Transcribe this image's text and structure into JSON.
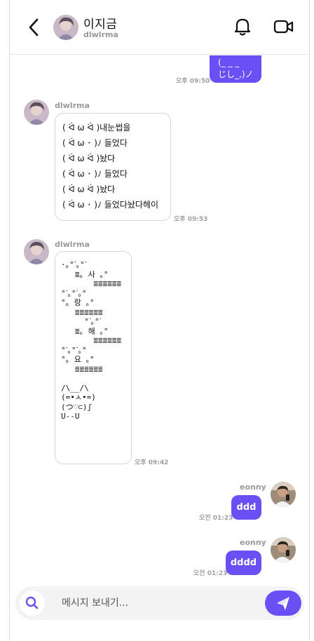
{
  "header": {
    "name": "이지금",
    "username": "dlwlrma"
  },
  "messages": {
    "top_partial": {
      "text_line1": "(_ _ _",
      "text_line2": "じし_,)ノ",
      "time": "오후 09:50"
    },
    "msg1": {
      "sender": "dlwlrma",
      "lines": [
        "( ᐛ ω ᐛ )내눈썹을",
        "( ᐛ ω ･ )ﾉ 들었다",
        "( ᐛ ω ᐛ )놨다",
        "( ᐛ ω ･ )ﾉ 들었다",
        "( ᐛ ω ᐛ )놨다",
        "( ᐛ ω ･ )ﾉ 들었다놨다헤이"
      ],
      "time": "오후 09:53"
    },
    "msg2": {
      "sender": "dlwlrma",
      "art": "·｡°ᐝ｡°ᐝ\n   ≣｡ 사 ｡°\n       ≣≣≣≣≣≣\n°ᐝ｡°ᐝ｡°\n°｡ 랑 ｡°\n   ≣≣≣≣≣≣\n     °ᐝ｡°ᐝ\n   ≣｡ 해 ｡°\n       ≣≣≣≣≣≣\n°ᐝ｡°ᐝ｡°\n°｡ 요 ｡°\n   ≣≣≣≣≣≣\n\n/\\__/\\\n(=•ㅅ•=)\n(つ♡⊂)ʃ\nU--U",
      "time": "오후 09:42"
    },
    "msg3": {
      "sender": "eonny",
      "text": "ddd",
      "time": "오전 01:23"
    },
    "msg4": {
      "sender": "eonny",
      "text": "dddd",
      "time": "오전 01:23"
    }
  },
  "composer": {
    "placeholder": "메시지 보내기..."
  },
  "colors": {
    "accent": "#6a4ff5",
    "bubble_border": "#d6d6d6",
    "muted_text": "#9a9a9a",
    "composer_bg": "#f3f3f3"
  },
  "icons": {
    "back": "chevron-left-icon",
    "bell": "bell-icon",
    "video": "video-camera-icon",
    "search": "search-icon",
    "send": "paper-plane-icon"
  }
}
